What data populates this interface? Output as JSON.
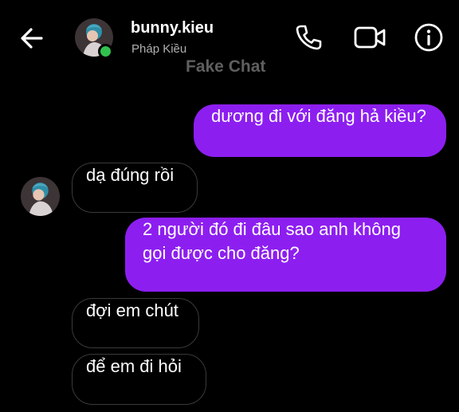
{
  "header": {
    "contact_name": "bunny.kieu",
    "contact_subtitle": "Pháp Kiều",
    "watermark": "Fake Chat",
    "online_status_color": "#31c24d",
    "icons": [
      "back-arrow-icon",
      "phone-icon",
      "video-camera-icon",
      "info-icon"
    ]
  },
  "messages": [
    {
      "direction": "outgoing",
      "text": "dương đi với đăng hả kiều?"
    },
    {
      "direction": "incoming",
      "text": "dạ đúng rồi"
    },
    {
      "direction": "outgoing",
      "text": "2 người đó đi đâu sao anh không gọi được cho đăng?"
    },
    {
      "direction": "incoming",
      "text": "đợi em chút"
    },
    {
      "direction": "incoming",
      "text": "để em đi hỏi"
    }
  ],
  "colors": {
    "background": "#000000",
    "outgoing_bubble": "#8d1ef0",
    "incoming_border": "#3a3a3a"
  }
}
